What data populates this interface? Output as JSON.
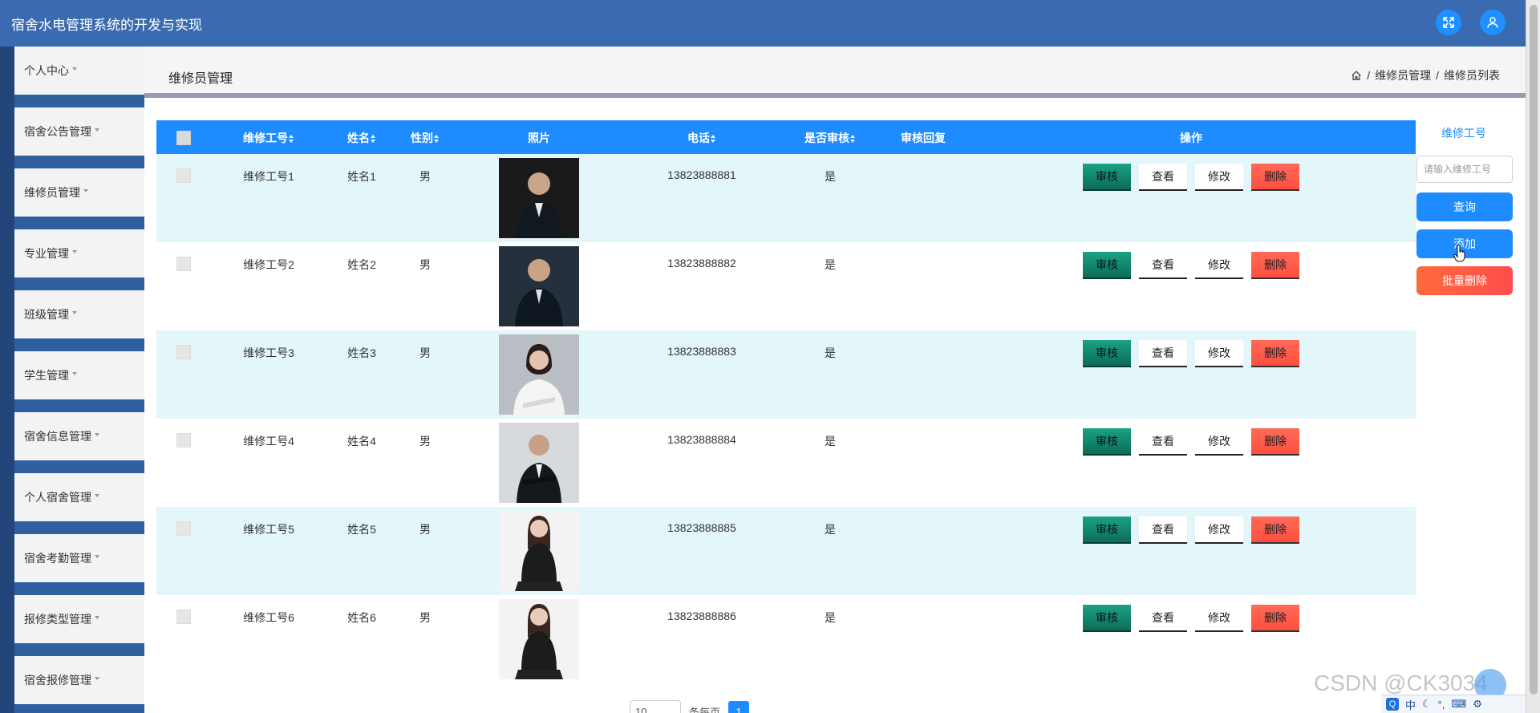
{
  "app": {
    "title": "宿舍水电管理系统的开发与实现"
  },
  "header_icons": [
    "fullscreen-icon",
    "user-icon"
  ],
  "sidebar": {
    "items": [
      {
        "label": "个人中心"
      },
      {
        "label": "宿舍公告管理"
      },
      {
        "label": "维修员管理"
      },
      {
        "label": "专业管理"
      },
      {
        "label": "班级管理"
      },
      {
        "label": "学生管理"
      },
      {
        "label": "宿舍信息管理"
      },
      {
        "label": "个人宿舍管理"
      },
      {
        "label": "宿舍考勤管理"
      },
      {
        "label": "报修类型管理"
      },
      {
        "label": "宿舍报修管理"
      }
    ]
  },
  "page": {
    "title": "维修员管理",
    "breadcrumb": {
      "sep": "/",
      "level1": "维修员管理",
      "level2": "维修员列表"
    }
  },
  "table": {
    "headers": {
      "staff_no": "维修工号",
      "name": "姓名",
      "gender": "性别",
      "photo": "照片",
      "phone": "电话",
      "reviewed": "是否审核",
      "review_reply": "审核回复",
      "actions": "操作"
    },
    "actions": {
      "audit": "审核",
      "view": "查看",
      "edit": "修改",
      "delete": "删除"
    },
    "rows": [
      {
        "staff_no": "维修工号1",
        "name": "姓名1",
        "gender": "男",
        "phone": "13823888881",
        "reviewed": "是",
        "review_reply": ""
      },
      {
        "staff_no": "维修工号2",
        "name": "姓名2",
        "gender": "男",
        "phone": "13823888882",
        "reviewed": "是",
        "review_reply": ""
      },
      {
        "staff_no": "维修工号3",
        "name": "姓名3",
        "gender": "男",
        "phone": "13823888883",
        "reviewed": "是",
        "review_reply": ""
      },
      {
        "staff_no": "维修工号4",
        "name": "姓名4",
        "gender": "男",
        "phone": "13823888884",
        "reviewed": "是",
        "review_reply": ""
      },
      {
        "staff_no": "维修工号5",
        "name": "姓名5",
        "gender": "男",
        "phone": "13823888885",
        "reviewed": "是",
        "review_reply": ""
      },
      {
        "staff_no": "维修工号6",
        "name": "姓名6",
        "gender": "男",
        "phone": "13823888886",
        "reviewed": "是",
        "review_reply": ""
      }
    ]
  },
  "search": {
    "label": "维修工号",
    "placeholder": "请输入维修工号",
    "query_label": "查询",
    "add_label": "添加",
    "batch_delete_label": "批量删除"
  },
  "pagination": {
    "page_size": "10",
    "per_page_label": "条每页",
    "current_page": "1"
  },
  "watermark": "CSDN @CK3034",
  "ime": {
    "lang": "中",
    "logo": "Q"
  },
  "colors": {
    "topbar": "#3a6bb0",
    "primary": "#1e8cff",
    "row_alt": "#e3f6f9",
    "audit": "#0d6b5a",
    "danger": "#ff4e3e"
  }
}
